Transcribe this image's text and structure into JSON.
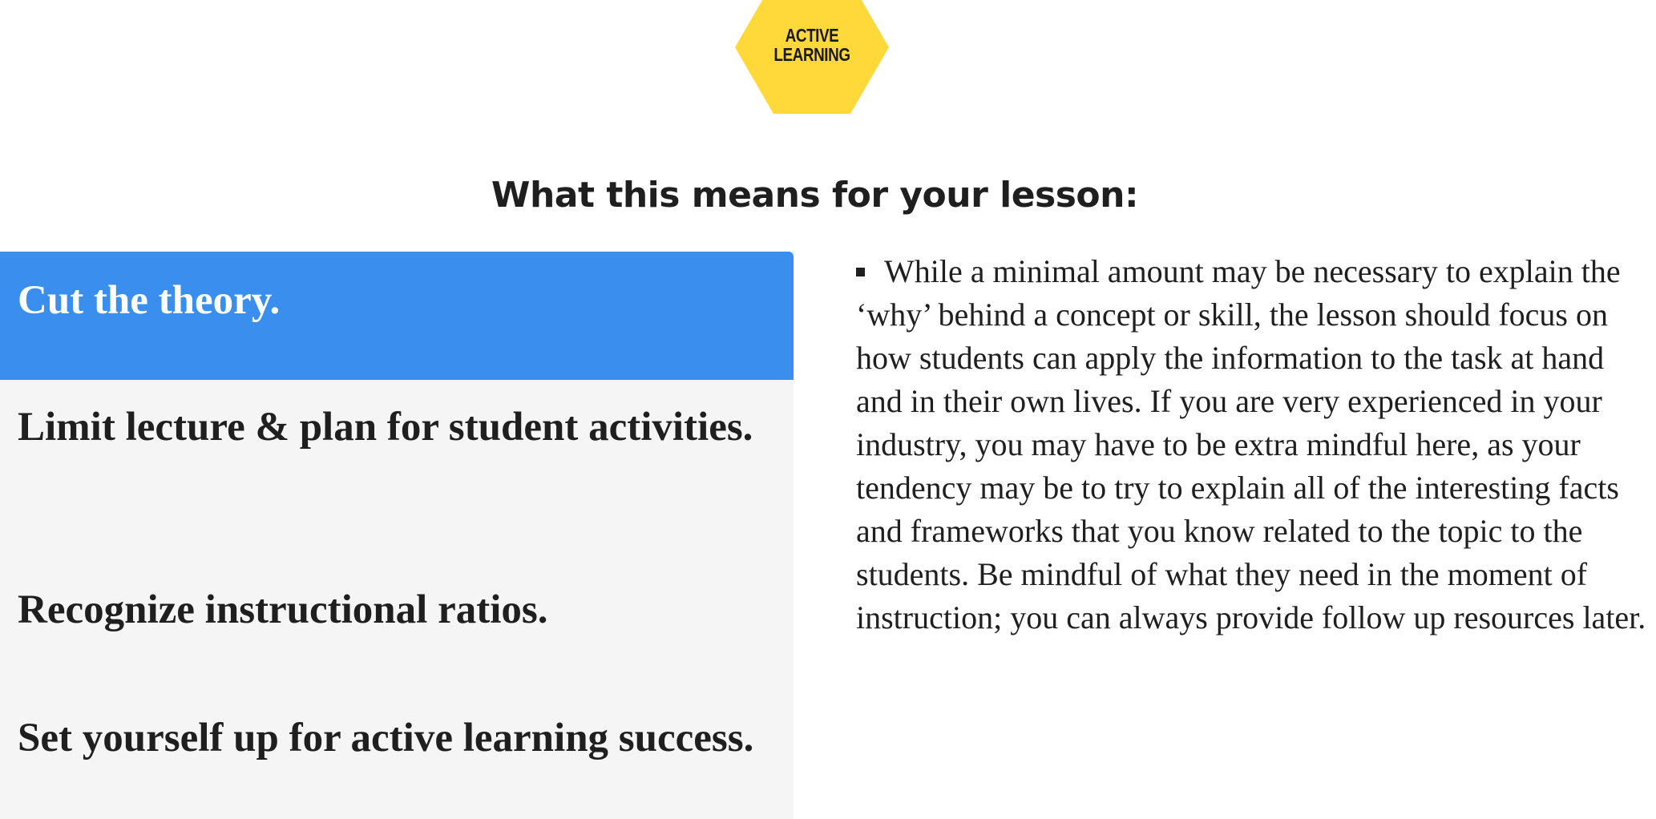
{
  "badge": {
    "line1": "ACTIVE",
    "line2": "LEARNING",
    "color": "#FFD83A"
  },
  "heading": "What this means for your lesson:",
  "tabs": [
    {
      "label": "Cut the theory.",
      "active": true
    },
    {
      "label": "Limit lecture & plan for student activities.",
      "active": false
    },
    {
      "label": "Recognize instructional ratios.",
      "active": false
    },
    {
      "label": "Set yourself up for active learning success.",
      "active": false
    }
  ],
  "content": {
    "text": "While a minimal amount may be necessary to explain the ‘why’ behind a concept or skill, the lesson should focus on how students can apply the information to the task at hand and in their own lives. If you are very experienced in your industry, you may have to be extra mindful here, as your tendency may be to try to explain all of the interesting facts and frameworks that you know related to the topic to the students. Be mindful of what they need in the moment of instruction; you can always provide follow up resources later."
  },
  "colors": {
    "active_tab": "#3A8FEE",
    "tab_panel_bg": "#F5F5F5",
    "text": "#1F1F1F"
  }
}
